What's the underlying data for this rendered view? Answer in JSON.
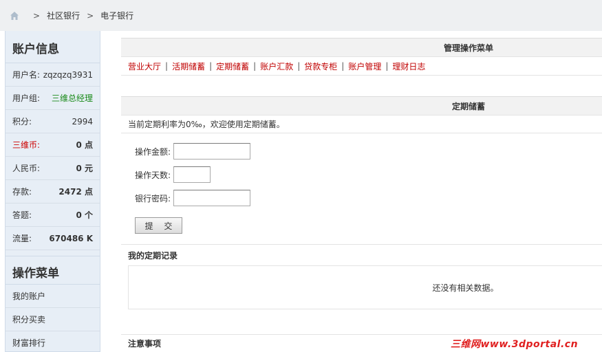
{
  "breadcrumb": {
    "items": [
      "社区银行",
      "电子银行"
    ],
    "separator": ">"
  },
  "account": {
    "title": "账户信息",
    "rows": [
      {
        "label": "用户名:",
        "value": "zqzqzq3931"
      },
      {
        "label": "用户组:",
        "value": "三维总经理"
      },
      {
        "label": "积分:",
        "value": "2994"
      },
      {
        "label": "三维币:",
        "value": "0 点"
      },
      {
        "label": "人民币:",
        "value": "0 元"
      },
      {
        "label": "存款:",
        "value": "2472 点"
      },
      {
        "label": "答题:",
        "value": "0 个"
      },
      {
        "label": "流量:",
        "value": "670486 K"
      }
    ]
  },
  "ops_menu": {
    "title": "操作菜单",
    "items": [
      "我的账户",
      "积分买卖",
      "财富排行"
    ]
  },
  "manage": {
    "title": "管理操作菜单",
    "links": [
      "营业大厅",
      "活期储蓄",
      "定期储蓄",
      "账户汇款",
      "贷款专柜",
      "账户管理",
      "理财日志"
    ],
    "separator": "|"
  },
  "fixed": {
    "title": "定期储蓄",
    "notice": "当前定期利率为0‰，欢迎使用定期储蓄。",
    "fields": [
      {
        "label": "操作金额:",
        "value": ""
      },
      {
        "label": "操作天数:",
        "value": ""
      },
      {
        "label": "银行密码:",
        "value": ""
      }
    ],
    "submit_label": "提 交"
  },
  "records": {
    "title": "我的定期记录",
    "empty_text": "还没有相关数据。"
  },
  "notes": {
    "title": "注意事项"
  },
  "watermark": "三维网www.3dportal.cn",
  "colors": {
    "link_red": "#c00000",
    "group_green": "#1a8a1a",
    "sidebar_bg": "#e7eef6"
  }
}
